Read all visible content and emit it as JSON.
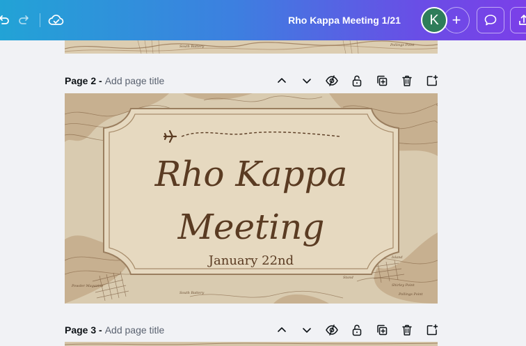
{
  "topbar": {
    "doc_title": "Rho Kappa Meeting 1/21",
    "avatar_initial": "K",
    "add_symbol": "+",
    "icons": [
      "undo-icon",
      "redo-icon",
      "cloud-saved-icon",
      "comment-icon",
      "share-upload-icon"
    ]
  },
  "pages": [
    {
      "label": "Page 2 -",
      "title_placeholder": "Add page title",
      "design": {
        "line1": "Rho Kappa",
        "line2": "Meeting",
        "date": "January 22nd"
      }
    },
    {
      "label": "Page 3 -",
      "title_placeholder": "Add page title"
    }
  ],
  "colors": {
    "topbar_start": "#22a3d6",
    "topbar_end": "#7b3fe8",
    "canvas_bg": "#f1f2f5",
    "paper": "#d8c9ad",
    "label_fill": "#e9dcc4",
    "ink": "#5a3b22"
  }
}
